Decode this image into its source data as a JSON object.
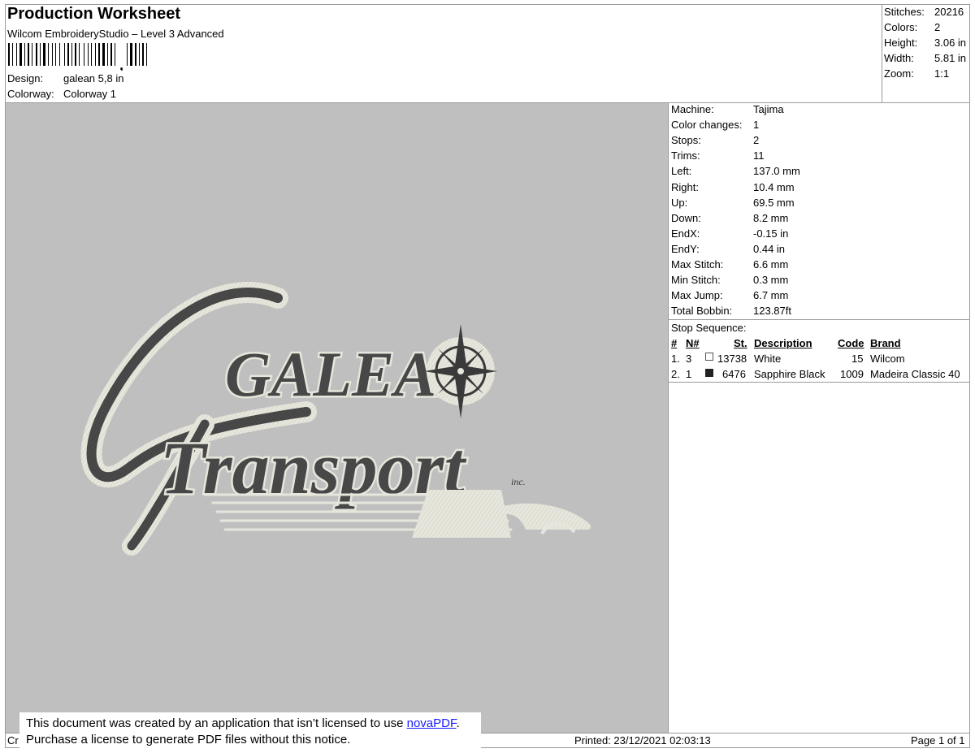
{
  "header": {
    "title": "Production Worksheet",
    "software": "Wilcom EmbroideryStudio – Level 3 Advanced",
    "design_label": "Design:",
    "design_value": "galean 5,8 in",
    "colorway_label": "Colorway:",
    "colorway_value": "Colorway 1"
  },
  "summary": [
    {
      "label": "Stitches:",
      "value": "20216"
    },
    {
      "label": "Colors:",
      "value": "2"
    },
    {
      "label": "Height:",
      "value": "3.06 in"
    },
    {
      "label": "Width:",
      "value": "5.81 in"
    },
    {
      "label": "Zoom:",
      "value": "1:1"
    }
  ],
  "properties": [
    {
      "label": "Machine:",
      "value": "Tajima"
    },
    {
      "label": "Color changes:",
      "value": "1"
    },
    {
      "label": "Stops:",
      "value": "2"
    },
    {
      "label": "Trims:",
      "value": "11"
    },
    {
      "label": "Left:",
      "value": "137.0 mm"
    },
    {
      "label": "Right:",
      "value": "10.4 mm"
    },
    {
      "label": "Up:",
      "value": "69.5 mm"
    },
    {
      "label": "Down:",
      "value": "8.2 mm"
    },
    {
      "label": "EndX:",
      "value": "-0.15 in"
    },
    {
      "label": "EndY:",
      "value": "0.44 in"
    },
    {
      "label": "Max Stitch:",
      "value": "6.6 mm"
    },
    {
      "label": "Min Stitch:",
      "value": "0.3 mm"
    },
    {
      "label": "Max Jump:",
      "value": "6.7 mm"
    },
    {
      "label": "Total Bobbin:",
      "value": "123.87ft"
    }
  ],
  "stop_sequence": {
    "title": "Stop Sequence:",
    "headers": {
      "index": "#",
      "needle": "N#",
      "stitches": "St.",
      "description": "Description",
      "code": "Code",
      "brand": "Brand"
    },
    "rows": [
      {
        "index": "1.",
        "needle": "3",
        "swatch": "#ffffff",
        "stitches": "13738",
        "description": "White",
        "code": "15",
        "brand": "Wilcom"
      },
      {
        "index": "2.",
        "needle": "1",
        "swatch": "#222222",
        "stitches": "6476",
        "description": "Sapphire Black",
        "code": "1009",
        "brand": "Madeira Classic 40"
      }
    ]
  },
  "design_preview": {
    "text_line1": "GALEAN",
    "text_line2": "Transport",
    "text_suffix": "inc.",
    "fill_color": "#4a4a4a",
    "outline_color": "#e8e8e0",
    "background": "#bfbfbf"
  },
  "notice": {
    "line1_text": "This document was created by an application that isn’t licensed to use ",
    "line1_link": "novaPDF",
    "line1_end": ".",
    "line2": "Purchase a license to generate PDF files without this notice."
  },
  "footer": {
    "left": "Cr",
    "printed": "Printed: 23/12/2021 02:03:13",
    "page": "Page 1 of 1"
  }
}
